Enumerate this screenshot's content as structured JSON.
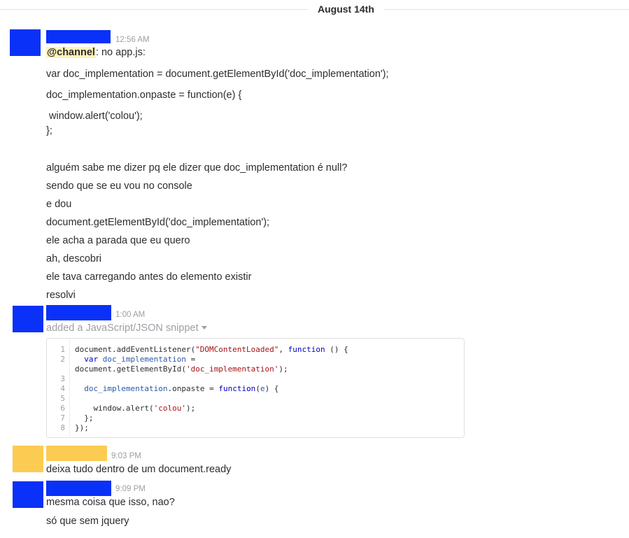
{
  "day_divider": {
    "label": "August 14th"
  },
  "colors": {
    "blue_redaction": "#0a31f7",
    "yellow_redaction": "#fccb51",
    "mention_bg": "#fff3b8"
  },
  "messages": [
    {
      "avatar_color": "blue",
      "timestamp": "12:56 AM",
      "lines": [
        {
          "mention": "@channel",
          "rest": ": no app.js:"
        },
        {
          "text": "var doc_implementation = document.getElementById('doc_implementation');"
        },
        {
          "text": "doc_implementation.onpaste = function(e) {"
        },
        {
          "text": " window.alert('colou');"
        },
        {
          "text": "};"
        },
        {
          "text": "alguém sabe me dizer pq ele dizer que doc_implementation é null?"
        },
        {
          "text": "sendo que se eu vou no console"
        },
        {
          "text": "e dou"
        },
        {
          "text": "document.getElementById('doc_implementation');"
        },
        {
          "text": "ele acha a parada que eu quero"
        },
        {
          "text": "ah, descobri"
        },
        {
          "text": "ele tava carregando antes do elemento existir"
        },
        {
          "text": "resolvi"
        }
      ]
    },
    {
      "avatar_color": "blue",
      "timestamp": "1:00 AM",
      "subtitle": "added a JavaScript/JSON snippet",
      "snippet": {
        "line_numbers": [
          "1",
          "2",
          "3",
          "4",
          "5",
          "6",
          "7",
          "8"
        ],
        "rows": [
          [
            {
              "t": "document.addEventListener(",
              "c": ""
            },
            {
              "t": "\"DOMContentLoaded\"",
              "c": "str"
            },
            {
              "t": ", ",
              "c": ""
            },
            {
              "t": "function",
              "c": "kw"
            },
            {
              "t": " () {",
              "c": ""
            }
          ],
          [
            {
              "t": "  ",
              "c": ""
            },
            {
              "t": "var",
              "c": "kw"
            },
            {
              "t": " ",
              "c": ""
            },
            {
              "t": "doc_implementation",
              "c": "var"
            },
            {
              "t": " =",
              "c": ""
            }
          ],
          [
            {
              "t": "document.getElementById(",
              "c": ""
            },
            {
              "t": "'doc_implementation'",
              "c": "str"
            },
            {
              "t": ");",
              "c": ""
            }
          ],
          [
            {
              "t": "",
              "c": ""
            }
          ],
          [
            {
              "t": "  ",
              "c": ""
            },
            {
              "t": "doc_implementation",
              "c": "var"
            },
            {
              "t": ".onpaste = ",
              "c": ""
            },
            {
              "t": "function",
              "c": "kw"
            },
            {
              "t": "(",
              "c": ""
            },
            {
              "t": "e",
              "c": "var"
            },
            {
              "t": ") {",
              "c": ""
            }
          ],
          [
            {
              "t": "",
              "c": ""
            }
          ],
          [
            {
              "t": "    window.alert(",
              "c": ""
            },
            {
              "t": "'colou'",
              "c": "str"
            },
            {
              "t": ");",
              "c": ""
            }
          ],
          [
            {
              "t": "  };",
              "c": ""
            }
          ],
          [
            {
              "t": "});",
              "c": ""
            }
          ]
        ]
      }
    },
    {
      "avatar_color": "yellow",
      "timestamp": "9:03 PM",
      "lines": [
        {
          "text": "deixa tudo dentro de um document.ready"
        }
      ]
    },
    {
      "avatar_color": "blue",
      "timestamp": "9:09 PM",
      "lines": [
        {
          "text": "mesma coisa que isso, nao?"
        },
        {
          "text": "só que sem jquery"
        }
      ]
    }
  ]
}
